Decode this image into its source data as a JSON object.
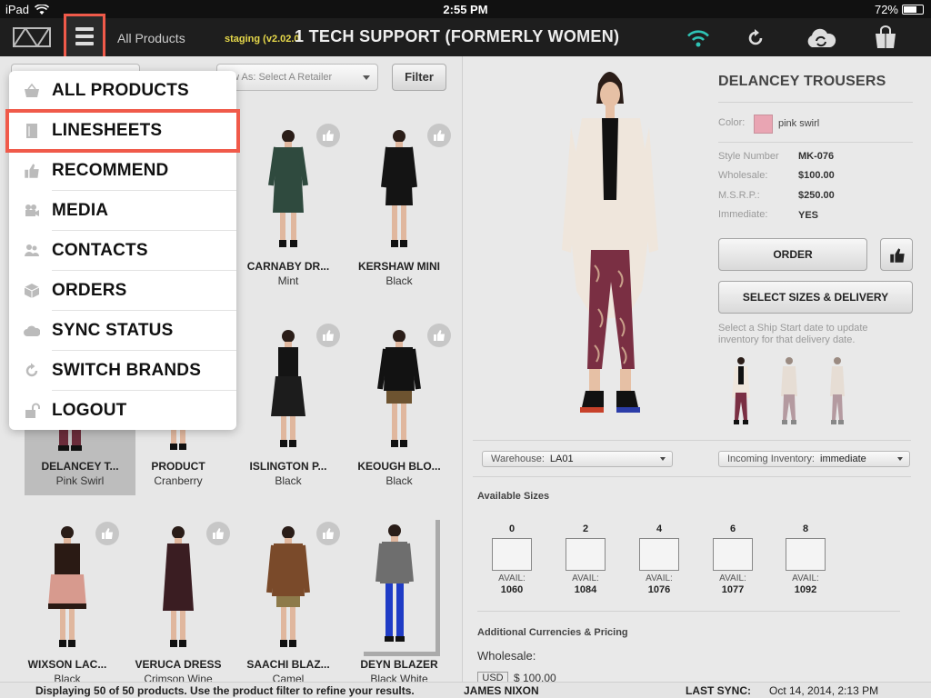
{
  "statusbar": {
    "device": "iPad",
    "time": "2:55 PM",
    "battery": "72%",
    "battery_level": 0.72
  },
  "navbar": {
    "breadcrumb": "All Products",
    "staging": "staging (v2.02.0.",
    "title": "1 TECH SUPPORT (FORMERLY WOMEN)"
  },
  "filter": {
    "retailer_placeholder": "ew As:  Select A Retailer",
    "filter_label": "Filter"
  },
  "menu": {
    "items": [
      {
        "label": "ALL PRODUCTS",
        "icon": "basket-icon"
      },
      {
        "label": "LINESHEETS",
        "icon": "notebook-icon"
      },
      {
        "label": "RECOMMEND",
        "icon": "thumbs-up-icon"
      },
      {
        "label": "MEDIA",
        "icon": "video-camera-icon"
      },
      {
        "label": "CONTACTS",
        "icon": "people-icon"
      },
      {
        "label": "ORDERS",
        "icon": "box-icon"
      },
      {
        "label": "SYNC STATUS",
        "icon": "cloud-sync-icon"
      },
      {
        "label": "SWITCH BRANDS",
        "icon": "refresh-icon"
      },
      {
        "label": "LOGOUT",
        "icon": "unlock-icon"
      }
    ]
  },
  "products": [
    {
      "name": "CARNABY DR...",
      "color": "Mint"
    },
    {
      "name": "KERSHAW MINI",
      "color": "Black"
    },
    {
      "name": "DELANCEY T...",
      "color": "Pink Swirl"
    },
    {
      "name": "PRODUCT",
      "color": "Cranberry"
    },
    {
      "name": "ISLINGTON P...",
      "color": "Black"
    },
    {
      "name": "KEOUGH BLO...",
      "color": "Black"
    },
    {
      "name": "WIXSON LAC...",
      "color": "Black"
    },
    {
      "name": "VERUCA DRESS",
      "color": "Crimson Wine"
    },
    {
      "name": "SAACHI BLAZ...",
      "color": "Camel"
    },
    {
      "name": "DEYN BLAZER",
      "color": "Black White"
    }
  ],
  "detail": {
    "title": "DELANCEY TROUSERS",
    "color_label": "Color:",
    "color_name": "pink swirl",
    "specs": [
      {
        "label": "Style Number",
        "value": "MK-076"
      },
      {
        "label": "Wholesale:",
        "value": "$100.00"
      },
      {
        "label": "M.S.R.P.:",
        "value": "$250.00"
      },
      {
        "label": "Immediate:",
        "value": "YES"
      }
    ],
    "order_label": "ORDER",
    "sizes_label": "SELECT SIZES & DELIVERY",
    "hint": "Select a Ship Start date to update inventory for that delivery date.",
    "warehouse_label": "Warehouse:",
    "warehouse_value": "LA01",
    "incoming_label": "Incoming Inventory:",
    "incoming_value": "immediate",
    "available_sizes_title": "Available Sizes",
    "sizes": [
      {
        "size": "0",
        "avail_label": "AVAIL:",
        "count": "1060"
      },
      {
        "size": "2",
        "avail_label": "AVAIL:",
        "count": "1084"
      },
      {
        "size": "4",
        "avail_label": "AVAIL:",
        "count": "1076"
      },
      {
        "size": "6",
        "avail_label": "AVAIL:",
        "count": "1077"
      },
      {
        "size": "8",
        "avail_label": "AVAIL:",
        "count": "1092"
      }
    ],
    "currencies_title": "Additional Currencies & Pricing",
    "wholesale_label": "Wholesale:",
    "currency_code": "USD",
    "currency_amount": "$ 100.00"
  },
  "bottombar": {
    "display_text": "Displaying 50 of 50 products.  Use the product filter to refine your results.",
    "user": "JAMES NIXON",
    "last_sync_label": "LAST SYNC:",
    "last_sync_value": "Oct 14, 2014, 2:13 PM"
  },
  "colors": {
    "accent": "#f05a4a",
    "wifi": "#2fc3b5",
    "swatch": "#e9a5b3"
  }
}
